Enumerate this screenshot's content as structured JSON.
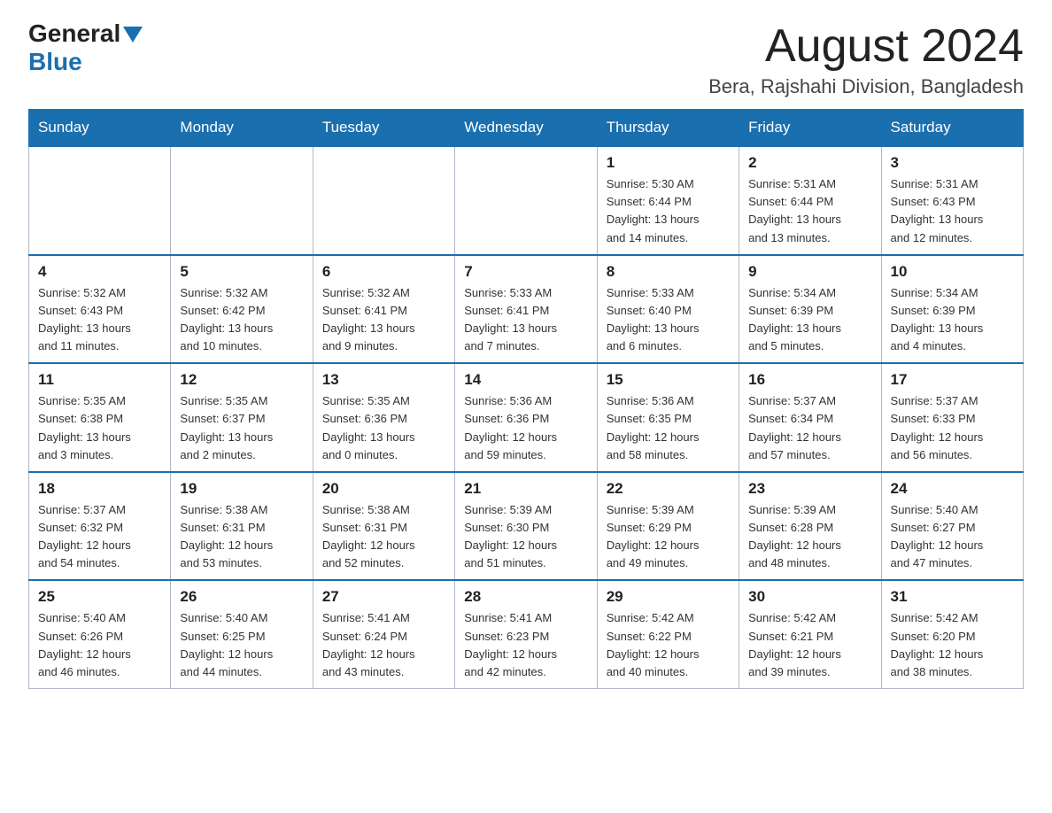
{
  "header": {
    "logo_general": "General",
    "logo_blue": "Blue",
    "month_title": "August 2024",
    "location": "Bera, Rajshahi Division, Bangladesh"
  },
  "days_of_week": [
    "Sunday",
    "Monday",
    "Tuesday",
    "Wednesday",
    "Thursday",
    "Friday",
    "Saturday"
  ],
  "weeks": [
    [
      {
        "day": "",
        "info": ""
      },
      {
        "day": "",
        "info": ""
      },
      {
        "day": "",
        "info": ""
      },
      {
        "day": "",
        "info": ""
      },
      {
        "day": "1",
        "info": "Sunrise: 5:30 AM\nSunset: 6:44 PM\nDaylight: 13 hours\nand 14 minutes."
      },
      {
        "day": "2",
        "info": "Sunrise: 5:31 AM\nSunset: 6:44 PM\nDaylight: 13 hours\nand 13 minutes."
      },
      {
        "day": "3",
        "info": "Sunrise: 5:31 AM\nSunset: 6:43 PM\nDaylight: 13 hours\nand 12 minutes."
      }
    ],
    [
      {
        "day": "4",
        "info": "Sunrise: 5:32 AM\nSunset: 6:43 PM\nDaylight: 13 hours\nand 11 minutes."
      },
      {
        "day": "5",
        "info": "Sunrise: 5:32 AM\nSunset: 6:42 PM\nDaylight: 13 hours\nand 10 minutes."
      },
      {
        "day": "6",
        "info": "Sunrise: 5:32 AM\nSunset: 6:41 PM\nDaylight: 13 hours\nand 9 minutes."
      },
      {
        "day": "7",
        "info": "Sunrise: 5:33 AM\nSunset: 6:41 PM\nDaylight: 13 hours\nand 7 minutes."
      },
      {
        "day": "8",
        "info": "Sunrise: 5:33 AM\nSunset: 6:40 PM\nDaylight: 13 hours\nand 6 minutes."
      },
      {
        "day": "9",
        "info": "Sunrise: 5:34 AM\nSunset: 6:39 PM\nDaylight: 13 hours\nand 5 minutes."
      },
      {
        "day": "10",
        "info": "Sunrise: 5:34 AM\nSunset: 6:39 PM\nDaylight: 13 hours\nand 4 minutes."
      }
    ],
    [
      {
        "day": "11",
        "info": "Sunrise: 5:35 AM\nSunset: 6:38 PM\nDaylight: 13 hours\nand 3 minutes."
      },
      {
        "day": "12",
        "info": "Sunrise: 5:35 AM\nSunset: 6:37 PM\nDaylight: 13 hours\nand 2 minutes."
      },
      {
        "day": "13",
        "info": "Sunrise: 5:35 AM\nSunset: 6:36 PM\nDaylight: 13 hours\nand 0 minutes."
      },
      {
        "day": "14",
        "info": "Sunrise: 5:36 AM\nSunset: 6:36 PM\nDaylight: 12 hours\nand 59 minutes."
      },
      {
        "day": "15",
        "info": "Sunrise: 5:36 AM\nSunset: 6:35 PM\nDaylight: 12 hours\nand 58 minutes."
      },
      {
        "day": "16",
        "info": "Sunrise: 5:37 AM\nSunset: 6:34 PM\nDaylight: 12 hours\nand 57 minutes."
      },
      {
        "day": "17",
        "info": "Sunrise: 5:37 AM\nSunset: 6:33 PM\nDaylight: 12 hours\nand 56 minutes."
      }
    ],
    [
      {
        "day": "18",
        "info": "Sunrise: 5:37 AM\nSunset: 6:32 PM\nDaylight: 12 hours\nand 54 minutes."
      },
      {
        "day": "19",
        "info": "Sunrise: 5:38 AM\nSunset: 6:31 PM\nDaylight: 12 hours\nand 53 minutes."
      },
      {
        "day": "20",
        "info": "Sunrise: 5:38 AM\nSunset: 6:31 PM\nDaylight: 12 hours\nand 52 minutes."
      },
      {
        "day": "21",
        "info": "Sunrise: 5:39 AM\nSunset: 6:30 PM\nDaylight: 12 hours\nand 51 minutes."
      },
      {
        "day": "22",
        "info": "Sunrise: 5:39 AM\nSunset: 6:29 PM\nDaylight: 12 hours\nand 49 minutes."
      },
      {
        "day": "23",
        "info": "Sunrise: 5:39 AM\nSunset: 6:28 PM\nDaylight: 12 hours\nand 48 minutes."
      },
      {
        "day": "24",
        "info": "Sunrise: 5:40 AM\nSunset: 6:27 PM\nDaylight: 12 hours\nand 47 minutes."
      }
    ],
    [
      {
        "day": "25",
        "info": "Sunrise: 5:40 AM\nSunset: 6:26 PM\nDaylight: 12 hours\nand 46 minutes."
      },
      {
        "day": "26",
        "info": "Sunrise: 5:40 AM\nSunset: 6:25 PM\nDaylight: 12 hours\nand 44 minutes."
      },
      {
        "day": "27",
        "info": "Sunrise: 5:41 AM\nSunset: 6:24 PM\nDaylight: 12 hours\nand 43 minutes."
      },
      {
        "day": "28",
        "info": "Sunrise: 5:41 AM\nSunset: 6:23 PM\nDaylight: 12 hours\nand 42 minutes."
      },
      {
        "day": "29",
        "info": "Sunrise: 5:42 AM\nSunset: 6:22 PM\nDaylight: 12 hours\nand 40 minutes."
      },
      {
        "day": "30",
        "info": "Sunrise: 5:42 AM\nSunset: 6:21 PM\nDaylight: 12 hours\nand 39 minutes."
      },
      {
        "day": "31",
        "info": "Sunrise: 5:42 AM\nSunset: 6:20 PM\nDaylight: 12 hours\nand 38 minutes."
      }
    ]
  ]
}
